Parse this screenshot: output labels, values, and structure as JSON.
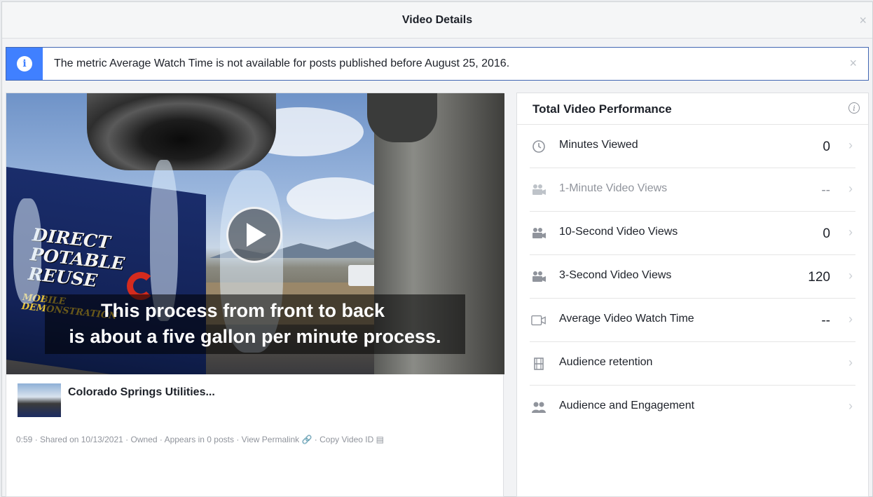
{
  "dialog": {
    "title": "Video Details",
    "close_glyph": "×"
  },
  "notice": {
    "icon": "info-icon",
    "message": "The metric Average Watch Time is not available for posts published before August 25, 2016.",
    "close_glyph": "×"
  },
  "video": {
    "overlay_title": [
      "DIRECT",
      "POTABLE",
      "REUSE"
    ],
    "overlay_subtitle": [
      "MOBILE",
      "DEMONSTRATION"
    ],
    "caption_line1": "This process from front to back",
    "caption_line2": "is about a five gallon per minute process.",
    "title": "Colorado Springs Utilities...",
    "meta": {
      "duration": "0:59",
      "shared": "Shared on 10/13/2021",
      "ownership": "Owned",
      "appears": "Appears in 0 posts",
      "permalink": "View Permalink",
      "copy_id": "Copy Video ID",
      "separator": "·"
    }
  },
  "performance": {
    "title": "Total Video Performance",
    "info_glyph": "i",
    "rows": [
      {
        "label": "Minutes Viewed",
        "value": "0",
        "icon": "clock-icon",
        "dim": false
      },
      {
        "label": "1-Minute Video Views",
        "value": "--",
        "icon": "video-camera-icon",
        "dim": true
      },
      {
        "label": "10-Second Video Views",
        "value": "0",
        "icon": "video-camera-icon",
        "dim": false
      },
      {
        "label": "3-Second Video Views",
        "value": "120",
        "icon": "video-camera-icon",
        "dim": false
      },
      {
        "label": "Average Video Watch Time",
        "value": "--",
        "icon": "video-outline-icon",
        "dim": false
      },
      {
        "label": "Audience retention",
        "value": "",
        "icon": "film-icon",
        "dim": false
      },
      {
        "label": "Audience and Engagement",
        "value": "",
        "icon": "people-icon",
        "dim": false
      }
    ],
    "chevron_glyph": "›"
  },
  "colors": {
    "accent": "#4080ff",
    "notice_border": "#4267b2",
    "muted_text": "#90949c"
  }
}
